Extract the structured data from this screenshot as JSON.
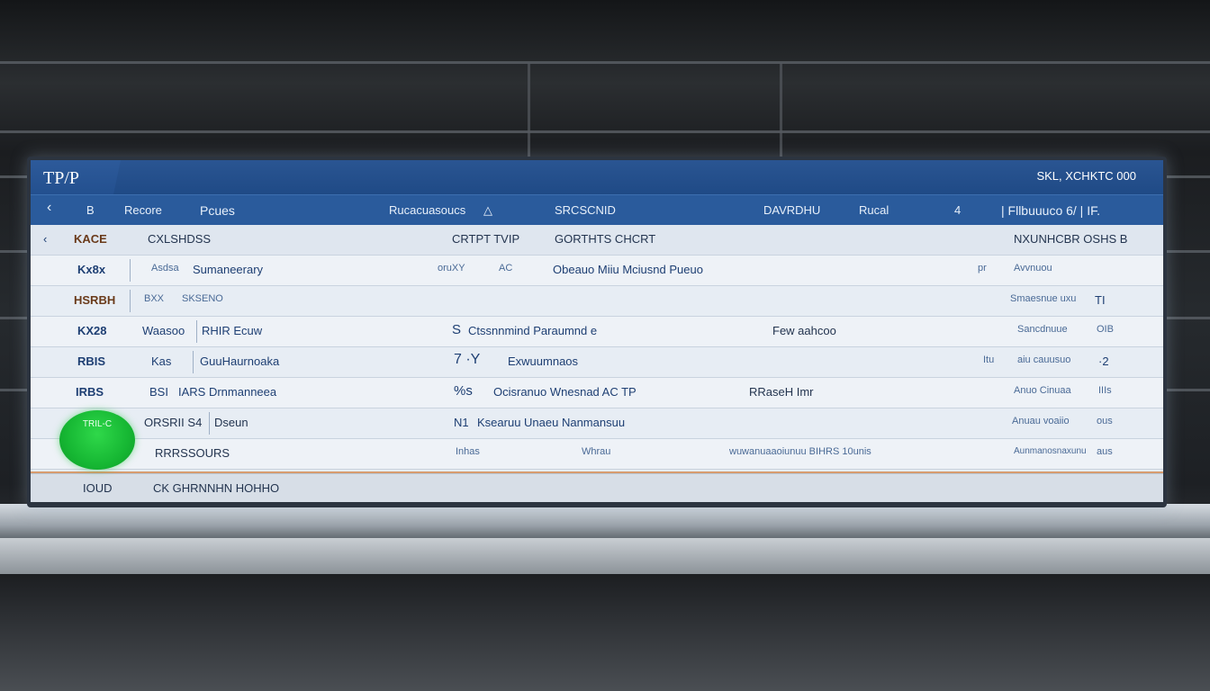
{
  "window": {
    "title": "TP/P",
    "right_label": "SKL, XCHKTC 000"
  },
  "toolbar": {
    "back": "‹",
    "items": [
      "B",
      "Recore",
      "Pcues",
      "Rucacuasoucs",
      "SRCSCNID",
      "DAVRDHU",
      "Rucal",
      "4"
    ],
    "filter_icon": "△",
    "right": "| Fllbuuuco 6/ | IF."
  },
  "header": {
    "c1": "‹",
    "c2": "KACE",
    "c3": "CXLSHDSS",
    "c4": "CRTPT TVIP",
    "c5": "GORTHTS CHCRT",
    "c6": "NXUNHCBR OSHS B"
  },
  "rows": [
    {
      "c1": "Kx8x",
      "c2": "Asdsa",
      "c3": "Sumaneerary",
      "c4": "oruXY",
      "c5": "AC",
      "c6": "Obeauo Miiu Mciusnd Pueuo",
      "c7": "pr",
      "c8": "Avvnuou",
      "c9": ""
    },
    {
      "c1": "HSRBH",
      "c2": "BXX",
      "c3": "SKSENO",
      "c4": "",
      "c5": "",
      "c6": "",
      "c7": "",
      "c8": "Smaesnue uxu",
      "c9": "TI"
    },
    {
      "c1": "KX28",
      "c2": "Waasoo",
      "c3": "RHIR Ecuw",
      "c4": "S",
      "c5": "",
      "c6": "Ctssnnmind Paraumnd e",
      "c7": "Few aahcoo",
      "c8": "Sancdnuue",
      "c9": "OIB"
    },
    {
      "c1": "RBIS",
      "c2": "Kas",
      "c3": "GuuHaurnoaka",
      "c4": "7 ·Y",
      "c5": "",
      "c6": "Exwuumnaos",
      "c7": "Itu",
      "c8": "aiu cauusuo",
      "c9": "·2"
    },
    {
      "c1": "IRBS",
      "c2": "BSI",
      "c3": "IARS Drnmanneea",
      "c4": "%s",
      "c5": "",
      "c6": "Ocisranuo Wnesnad AC TP",
      "c7": "RRaseH Imr",
      "c8": "Anuo Cinuaa",
      "c9": "IIIs"
    },
    {
      "c1": "",
      "c2": "ORSRII S4",
      "c3": "Dseun",
      "c4": "N1",
      "c5": "",
      "c6": "Ksearuu Unaeu Nanmansuu",
      "c7": "",
      "c8": "Anuau voaiio",
      "c9": "ous"
    },
    {
      "c1": "",
      "c2": "",
      "c3": "RRRSSOURS",
      "c4": "Inhas",
      "c5": "",
      "c6": "Whrau",
      "c7": "wuwanuaaoiunuu  BIHRS  10unis",
      "c8": "Aunmanosnaxunu",
      "c9": "aus"
    }
  ],
  "badge": {
    "label": "TRIL-C"
  },
  "footer": {
    "c1": "IOUD",
    "c2": "CK GHRNNHN HOHHO"
  },
  "colors": {
    "titlebar": "#1f4a86",
    "toolbar": "#2a5b9c",
    "badge": "#16b733",
    "accent": "#d07a36"
  }
}
